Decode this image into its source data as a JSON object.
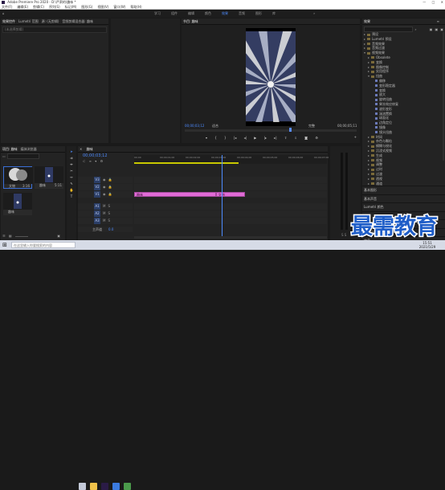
{
  "window": {
    "title": "Adobe Premiere Pro 2020 - D:\\严肃的\\趣味 *",
    "menu": [
      "文件(F)",
      "编辑(E)",
      "剪辑(C)",
      "序列(S)",
      "标记(M)",
      "图形(G)",
      "视图(V)",
      "窗口(W)",
      "帮助(H)"
    ]
  },
  "workspaces": {
    "tabs": [
      "学习",
      "组件",
      "编辑",
      "颜色",
      "效果",
      "音频",
      "图形",
      "库"
    ],
    "active_index": 4
  },
  "source_panel": {
    "tabs": [
      "效果控件",
      "Lumetri 范围",
      "源: (无剪辑)",
      "音频剪辑混合器: 趣味"
    ],
    "field_hint": "(未选择剪辑)"
  },
  "program_panel": {
    "title": "节目: 趣味",
    "timecode_left": "00;00;03;12",
    "fit_label": "适合",
    "quality_label": "完整",
    "timecode_right": "00;00;05;11"
  },
  "effects_panel": {
    "title": "效果",
    "search_placeholder": "",
    "items": [
      {
        "label": "预设",
        "level": 0,
        "kind": "folder",
        "expanded": false
      },
      {
        "label": "Lumetri 预设",
        "level": 0,
        "kind": "folder",
        "expanded": false
      },
      {
        "label": "音频效果",
        "level": 0,
        "kind": "folder",
        "expanded": false
      },
      {
        "label": "音频过渡",
        "level": 0,
        "kind": "folder",
        "expanded": false
      },
      {
        "label": "视频效果",
        "level": 0,
        "kind": "folder",
        "expanded": true
      },
      {
        "label": "Obsolete",
        "level": 1,
        "kind": "folder",
        "expanded": false
      },
      {
        "label": "变换",
        "level": 1,
        "kind": "folder",
        "expanded": false
      },
      {
        "label": "图像控制",
        "level": 1,
        "kind": "folder",
        "expanded": false
      },
      {
        "label": "实用程序",
        "level": 1,
        "kind": "folder",
        "expanded": false
      },
      {
        "label": "扭曲",
        "level": 1,
        "kind": "folder",
        "expanded": true
      },
      {
        "label": "偏移",
        "level": 2,
        "kind": "effect"
      },
      {
        "label": "变形稳定器",
        "level": 2,
        "kind": "effect"
      },
      {
        "label": "变换",
        "level": 2,
        "kind": "effect"
      },
      {
        "label": "放大",
        "level": 2,
        "kind": "effect"
      },
      {
        "label": "旋转扭曲",
        "level": 2,
        "kind": "effect"
      },
      {
        "label": "果冻效应修复",
        "level": 2,
        "kind": "effect"
      },
      {
        "label": "波形变形",
        "level": 2,
        "kind": "effect"
      },
      {
        "label": "湍流置换",
        "level": 2,
        "kind": "effect"
      },
      {
        "label": "球面化",
        "level": 2,
        "kind": "effect"
      },
      {
        "label": "边角定位",
        "level": 2,
        "kind": "effect"
      },
      {
        "label": "镜像",
        "level": 2,
        "kind": "effect"
      },
      {
        "label": "镜头扭曲",
        "level": 2,
        "kind": "effect"
      },
      {
        "label": "时间",
        "level": 1,
        "kind": "folder",
        "expanded": false
      },
      {
        "label": "杂色与颗粒",
        "level": 1,
        "kind": "folder",
        "expanded": false
      },
      {
        "label": "模糊与锐化",
        "level": 1,
        "kind": "folder",
        "expanded": false
      },
      {
        "label": "沉浸式视频",
        "level": 1,
        "kind": "folder",
        "expanded": false
      },
      {
        "label": "生成",
        "level": 1,
        "kind": "folder",
        "expanded": false
      },
      {
        "label": "视频",
        "level": 1,
        "kind": "folder",
        "expanded": false
      },
      {
        "label": "调整",
        "level": 1,
        "kind": "folder",
        "expanded": false
      },
      {
        "label": "过时",
        "level": 1,
        "kind": "folder",
        "expanded": false
      },
      {
        "label": "过渡",
        "level": 1,
        "kind": "folder",
        "expanded": false
      },
      {
        "label": "透视",
        "level": 1,
        "kind": "folder",
        "expanded": false
      },
      {
        "label": "通道",
        "level": 1,
        "kind": "folder",
        "expanded": false
      },
      {
        "label": "键控",
        "level": 1,
        "kind": "folder",
        "expanded": false
      },
      {
        "label": "颜色校正",
        "level": 1,
        "kind": "folder",
        "expanded": false
      },
      {
        "label": "风格化",
        "level": 1,
        "kind": "folder",
        "expanded": false
      }
    ],
    "bottom_sections": [
      "基本图形",
      "基本声音",
      "Lumetri 颜色",
      "库",
      "标记",
      "历史记录",
      "信息"
    ]
  },
  "project_panel": {
    "tabs": [
      "项目: 趣味",
      "媒体浏览器"
    ],
    "search_placeholder": "",
    "items": [
      {
        "label": "文物",
        "duration": "3:16"
      },
      {
        "label": "趣味",
        "duration": "5:11"
      },
      {
        "label": "趣味",
        "duration": ""
      }
    ]
  },
  "timeline": {
    "sequence_tab": "趣味",
    "timecode": "00;00;03;12",
    "ruler_labels": [
      "00;00",
      "00;00;01;00",
      "00;00;02;00",
      "00;00;03;00",
      "00;00;04;00",
      "00;00;05;00",
      "00;00;06;00",
      "00;00;07;00"
    ],
    "video_tracks": [
      "V3",
      "V2",
      "V1"
    ],
    "audio_tracks": [
      "A1",
      "A2",
      "A3"
    ],
    "master_label": "主声道",
    "master_value": "0.0",
    "clips": [
      {
        "label": "趣味",
        "track": "V1",
        "color": "#e06bd6",
        "start": 0.0,
        "end": 3.18
      },
      {
        "label": "文物",
        "track": "V1",
        "color": "#e06bd6",
        "start": 3.18,
        "end": 4.3
      }
    ],
    "playhead_time": 3.4
  },
  "taskbar": {
    "search_hint": "在这里输入你要搜索的内容",
    "time": "15:51",
    "date": "2021/5/29"
  },
  "watermark": {
    "text": "最需教育",
    "color": "#1f5ec8"
  }
}
